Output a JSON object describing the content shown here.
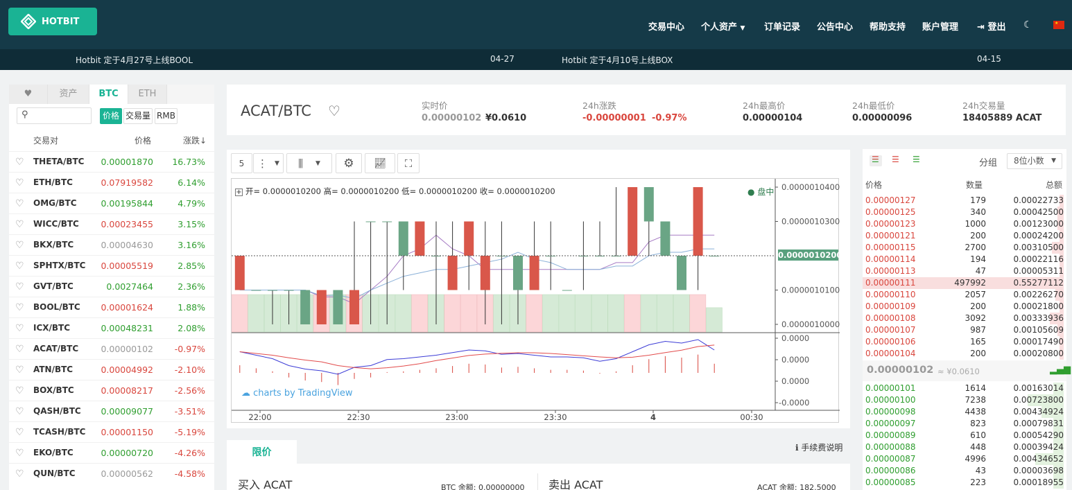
{
  "header": {
    "logo": "HOTBIT",
    "nav": [
      "交易中心",
      "个人资产",
      "订单记录",
      "公告中心",
      "帮助支持",
      "账户管理",
      "登出"
    ]
  },
  "ticker": [
    {
      "text": "Hotbit 定于4月27号上线BOOL",
      "date": "04-27"
    },
    {
      "text": "Hotbit 定于4月10号上线BOX",
      "date": "04-15"
    }
  ],
  "market": {
    "tabs": [
      "资产",
      "BTC",
      "ETH"
    ],
    "sort": [
      "价格",
      "交易量",
      "RMB"
    ],
    "columns": [
      "交易对",
      "价格",
      "涨跌↓"
    ],
    "rows": [
      {
        "pair": "THETA/BTC",
        "price": "0.00001870",
        "change": "16.73%",
        "dir": "up"
      },
      {
        "pair": "ETH/BTC",
        "price": "0.07919582",
        "change": "6.14%",
        "dir": "down"
      },
      {
        "pair": "OMG/BTC",
        "price": "0.00195844",
        "change": "4.79%",
        "dir": "up"
      },
      {
        "pair": "WICC/BTC",
        "price": "0.00023455",
        "change": "3.15%",
        "dir": "down"
      },
      {
        "pair": "BKX/BTC",
        "price": "0.00004630",
        "change": "3.16%",
        "dir": "flat"
      },
      {
        "pair": "SPHTX/BTC",
        "price": "0.00005519",
        "change": "2.85%",
        "dir": "down"
      },
      {
        "pair": "GVT/BTC",
        "price": "0.0027464",
        "change": "2.36%",
        "dir": "up"
      },
      {
        "pair": "BOOL/BTC",
        "price": "0.00001624",
        "change": "1.88%",
        "dir": "down"
      },
      {
        "pair": "ICX/BTC",
        "price": "0.00048231",
        "change": "2.08%",
        "dir": "up"
      },
      {
        "pair": "ACAT/BTC",
        "price": "0.00000102",
        "change": "-0.97%",
        "dir": "flat"
      },
      {
        "pair": "ATN/BTC",
        "price": "0.00004992",
        "change": "-2.10%",
        "dir": "down"
      },
      {
        "pair": "BOX/BTC",
        "price": "0.00008217",
        "change": "-2.56%",
        "dir": "down"
      },
      {
        "pair": "QASH/BTC",
        "price": "0.00009077",
        "change": "-3.51%",
        "dir": "up"
      },
      {
        "pair": "TCASH/BTC",
        "price": "0.00001150",
        "change": "-5.19%",
        "dir": "down"
      },
      {
        "pair": "EKO/BTC",
        "price": "0.00000720",
        "change": "-4.26%",
        "dir": "up"
      },
      {
        "pair": "QUN/BTC",
        "price": "0.00000562",
        "change": "-4.58%",
        "dir": "flat"
      }
    ]
  },
  "info": {
    "pair": "ACAT/BTC",
    "items": [
      {
        "label": "实时价",
        "value": "0.00000102",
        "extra": "¥0.0610"
      },
      {
        "label": "24h涨跌",
        "value": "-0.00000001",
        "extra": "-0.97%"
      },
      {
        "label": "24h最高价",
        "value": "0.00000104"
      },
      {
        "label": "24h最低价",
        "value": "0.00000096"
      },
      {
        "label": "24h交易量",
        "value": "18405889 ACAT"
      }
    ]
  },
  "chart": {
    "interval": "5",
    "legend": "开= 0.0000010200 高= 0.0000010200 低= 0.0000010200 收= 0.0000010200",
    "status": "盘中",
    "current": "0.0000010200",
    "watermark": "charts by TradingView",
    "yTicks": [
      "0.0000010400",
      "0.0000010300",
      "0.0000010200",
      "0.0000010100",
      "0.0000010000"
    ],
    "subTicks": [
      "0.0000",
      "0.0000",
      "0.0000",
      "-0.0000"
    ],
    "xTicks": [
      "22:00",
      "22:30",
      "23:00",
      "23:30",
      "4",
      "00:30"
    ]
  },
  "chart_data": {
    "type": "candlestick",
    "o": [
      1.02,
      1.01,
      1.01,
      1.01,
      1.0,
      1.01,
      1.0,
      1.01,
      1.03,
      1.03,
      1.02,
      1.03,
      1.02,
      1.02,
      1.03,
      1.02,
      1.02,
      1.01,
      1.02,
      1.02,
      1.01,
      1.02,
      1.02,
      1.02,
      1.04,
      1.03,
      1.02,
      1.01,
      1.04,
      1.02
    ],
    "h": [
      1.02,
      1.01,
      1.01,
      1.01,
      1.01,
      1.01,
      1.01,
      1.03,
      1.03,
      1.03,
      1.03,
      1.03,
      1.03,
      1.03,
      1.03,
      1.03,
      1.03,
      1.02,
      1.03,
      1.03,
      1.01,
      1.03,
      1.03,
      1.04,
      1.04,
      1.03,
      1.03,
      1.02,
      1.04,
      1.02
    ],
    "l": [
      1.01,
      1.01,
      1.0,
      1.0,
      1.0,
      1.0,
      1.0,
      1.0,
      1.0,
      1.0,
      1.01,
      1.02,
      1.0,
      1.02,
      1.01,
      1.0,
      1.0,
      1.0,
      1.01,
      1.01,
      1.01,
      1.01,
      1.02,
      1.02,
      1.02,
      1.02,
      1.02,
      1.01,
      1.01,
      1.02
    ],
    "c": [
      1.01,
      1.01,
      1.01,
      1.01,
      1.01,
      1.0,
      1.01,
      1.0,
      1.03,
      1.03,
      1.03,
      1.02,
      1.02,
      1.01,
      1.02,
      1.01,
      1.02,
      1.02,
      1.01,
      1.02,
      1.01,
      1.02,
      1.02,
      1.02,
      1.02,
      1.04,
      1.03,
      1.02,
      1.02,
      1.02
    ],
    "vol": [
      2,
      2,
      2,
      2,
      2,
      2,
      2,
      2,
      2,
      2,
      2,
      2,
      2,
      2,
      2,
      2,
      2,
      2,
      2,
      2,
      2,
      2,
      2,
      2,
      2,
      2,
      2,
      2,
      2,
      1.3
    ],
    "macd": [
      0.5,
      0.3,
      0.1,
      -0.3,
      -0.5,
      -0.6,
      -0.8,
      -0.4,
      -0.3,
      0.05,
      0.1,
      0.2,
      0.3,
      0.45,
      0.6,
      0.55,
      0.35,
      0.4,
      0.3,
      0.2,
      0.2,
      0.15,
      -0.05,
      0.1,
      0.5,
      0.9,
      1.1,
      1.0,
      1.2,
      0.6
    ]
  },
  "orderbook": {
    "group_label": "分组",
    "precision": "8位小数",
    "columns": [
      "价格",
      "数量",
      "总额"
    ],
    "asks": [
      {
        "price": "0.00000127",
        "qty": "179",
        "total": "0.00022733",
        "depth": 0.02
      },
      {
        "price": "0.00000125",
        "qty": "340",
        "total": "0.00042500",
        "depth": 0.03
      },
      {
        "price": "0.00000123",
        "qty": "1000",
        "total": "0.00123000",
        "depth": 0.03
      },
      {
        "price": "0.00000121",
        "qty": "200",
        "total": "0.00024200",
        "depth": 0.02
      },
      {
        "price": "0.00000115",
        "qty": "2700",
        "total": "0.00310500",
        "depth": 0.06
      },
      {
        "price": "0.00000114",
        "qty": "194",
        "total": "0.00022116",
        "depth": 0.02
      },
      {
        "price": "0.00000113",
        "qty": "47",
        "total": "0.00005311",
        "depth": 0.02
      },
      {
        "price": "0.00000111",
        "qty": "497992",
        "total": "0.55277112",
        "depth": 1.0
      },
      {
        "price": "0.00000110",
        "qty": "2057",
        "total": "0.00226270",
        "depth": 0.04
      },
      {
        "price": "0.00000109",
        "qty": "200",
        "total": "0.00021800",
        "depth": 0.02
      },
      {
        "price": "0.00000108",
        "qty": "3092",
        "total": "0.00333936",
        "depth": 0.07
      },
      {
        "price": "0.00000107",
        "qty": "987",
        "total": "0.00105609",
        "depth": 0.03
      },
      {
        "price": "0.00000106",
        "qty": "165",
        "total": "0.00017490",
        "depth": 0.02
      },
      {
        "price": "0.00000104",
        "qty": "200",
        "total": "0.00020800",
        "depth": 0.02
      }
    ],
    "last": {
      "price": "0.00000102",
      "cny": "≈ ¥0.0610"
    },
    "bids": [
      {
        "price": "0.00000101",
        "qty": "1614",
        "total": "0.00163014",
        "depth": 0.05
      },
      {
        "price": "0.00000100",
        "qty": "7238",
        "total": "0.00723800",
        "depth": 0.18
      },
      {
        "price": "0.00000098",
        "qty": "4438",
        "total": "0.00434924",
        "depth": 0.11
      },
      {
        "price": "0.00000097",
        "qty": "823",
        "total": "0.00079831",
        "depth": 0.05
      },
      {
        "price": "0.00000089",
        "qty": "610",
        "total": "0.00054290",
        "depth": 0.05
      },
      {
        "price": "0.00000088",
        "qty": "448",
        "total": "0.00039424",
        "depth": 0.05
      },
      {
        "price": "0.00000087",
        "qty": "4996",
        "total": "0.00434652",
        "depth": 0.14
      },
      {
        "price": "0.00000086",
        "qty": "43",
        "total": "0.00003698",
        "depth": 0.05
      },
      {
        "price": "0.00000085",
        "qty": "223",
        "total": "0.00018955",
        "depth": 0.05
      }
    ]
  },
  "order_form": {
    "tab": "限价",
    "fee_link": "手续费说明",
    "buy_title": "买入 ACAT",
    "buy_balance": "BTC 余额: 0.00000000",
    "sell_title": "卖出 ACAT",
    "sell_balance": "ACAT 余额: 182.5000"
  },
  "colors": {
    "up": "#2f9e2f",
    "down": "#d9463d",
    "accent": "#1ab394",
    "header": "#153a48"
  }
}
